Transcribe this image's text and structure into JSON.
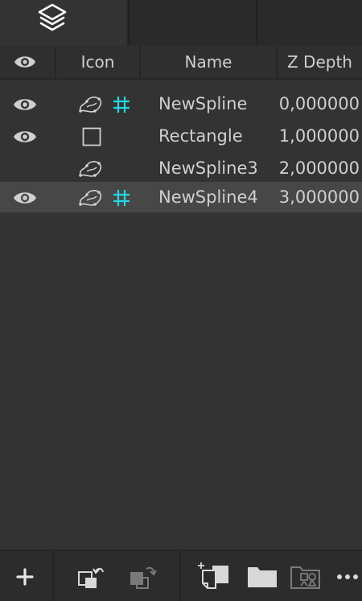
{
  "tabs": [
    {
      "icon": "layers-icon",
      "active": true
    },
    {
      "icon": "",
      "active": false
    },
    {
      "icon": "",
      "active": false
    }
  ],
  "columns": {
    "visibility_icon": "eye-icon",
    "icon": "Icon",
    "name": "Name",
    "z_depth": "Z Depth"
  },
  "layers": [
    {
      "visible": true,
      "type_icon": "spline-icon",
      "has_hash": true,
      "name": "NewSpline",
      "z_depth": "0,000000",
      "selected": false
    },
    {
      "visible": true,
      "type_icon": "rectangle-icon",
      "has_hash": false,
      "name": "Rectangle",
      "z_depth": "1,000000",
      "selected": false
    },
    {
      "visible": false,
      "type_icon": "spline-icon",
      "has_hash": false,
      "name": "NewSpline3",
      "z_depth": "2,000000",
      "selected": false
    },
    {
      "visible": true,
      "type_icon": "spline-icon",
      "has_hash": true,
      "name": "NewSpline4",
      "z_depth": "3,000000",
      "selected": true
    }
  ],
  "toolbar": [
    {
      "icon": "add-icon"
    },
    {
      "icon": "bring-forward-icon"
    },
    {
      "icon": "send-backward-icon"
    },
    {
      "icon": "new-layer-icon"
    },
    {
      "icon": "folder-icon"
    },
    {
      "icon": "shapes-folder-icon"
    },
    {
      "icon": "more-icon"
    }
  ],
  "colors": {
    "background": "#333333",
    "selected_row": "#474747",
    "hash_accent": "#23d6e0",
    "text": "#cfcfcf"
  }
}
